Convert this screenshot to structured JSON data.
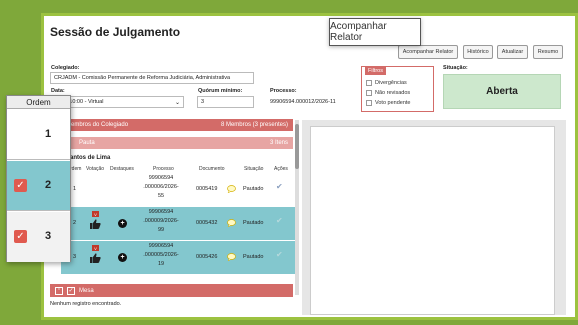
{
  "title": "Sessão de Julgamento",
  "tooltip": "Acompanhar Relator",
  "buttons": {
    "acompanhar": "Acompanhar Relator",
    "historico": "Histórico",
    "atualizar": "Atualizar",
    "resumo": "Resumo"
  },
  "form": {
    "colegiado_label": "Colegiado:",
    "colegiado_value": "CRJADM - Comissão Permanente de Reforma Judiciária, Administrativa",
    "data_label": "Data:",
    "data_value": "/2026 10:00 - Virtual",
    "quorum_label": "Quórum mínimo:",
    "quorum_value": "3",
    "processo_label": "Processo:",
    "processo_value": "99906594.000012/2026-11",
    "situacao_label": "Situação:",
    "situacao_value": "Aberta"
  },
  "filtros": {
    "title": "Filtros",
    "options": [
      "Divergências",
      "Não revisados",
      "Voto pendente"
    ]
  },
  "sections": {
    "membros": "embros do Colegiado",
    "membros_count": "8 Membros (3 presentes)",
    "pauta": "Pauta",
    "pauta_count": "3 Itens",
    "mesa": "Mesa",
    "mesa_empty": "Nenhum registro encontrado."
  },
  "group_name": "antos de Lima",
  "table_headers": [
    "rdem",
    "Votação",
    "Destaques",
    "Processo",
    "Documento",
    "Situação",
    "Ações"
  ],
  "rows": [
    {
      "ordem": "1",
      "processo": [
        "99906594",
        ".000006/2026-",
        "55"
      ],
      "documento": "0005419",
      "situacao": "Pautado",
      "vote_badge": "",
      "teal": false
    },
    {
      "ordem": "2",
      "processo": [
        "99906594",
        ".000009/2026-",
        "99"
      ],
      "documento": "0005432",
      "situacao": "Pautado",
      "vote_badge": "V",
      "teal": true
    },
    {
      "ordem": "3",
      "processo": [
        "99906594",
        ".000005/2026-",
        "19"
      ],
      "documento": "0005426",
      "situacao": "Pautado",
      "vote_badge": "V",
      "teal": true
    }
  ],
  "ordem_panel": {
    "header": "Ordem",
    "items": [
      {
        "num": "1",
        "checked": false
      },
      {
        "num": "2",
        "checked": true
      },
      {
        "num": "3",
        "checked": true
      }
    ]
  },
  "colors": {
    "background": "#7fa83a",
    "accent_red": "#d36b68",
    "teal_row": "#83c7ce",
    "situacao_green": "#cde8cd"
  },
  "icons": [
    "thumbs-up-icon",
    "plus-circle-icon",
    "comment-icon",
    "check-icon",
    "chevron-up-icon",
    "checkbox-icon"
  ]
}
